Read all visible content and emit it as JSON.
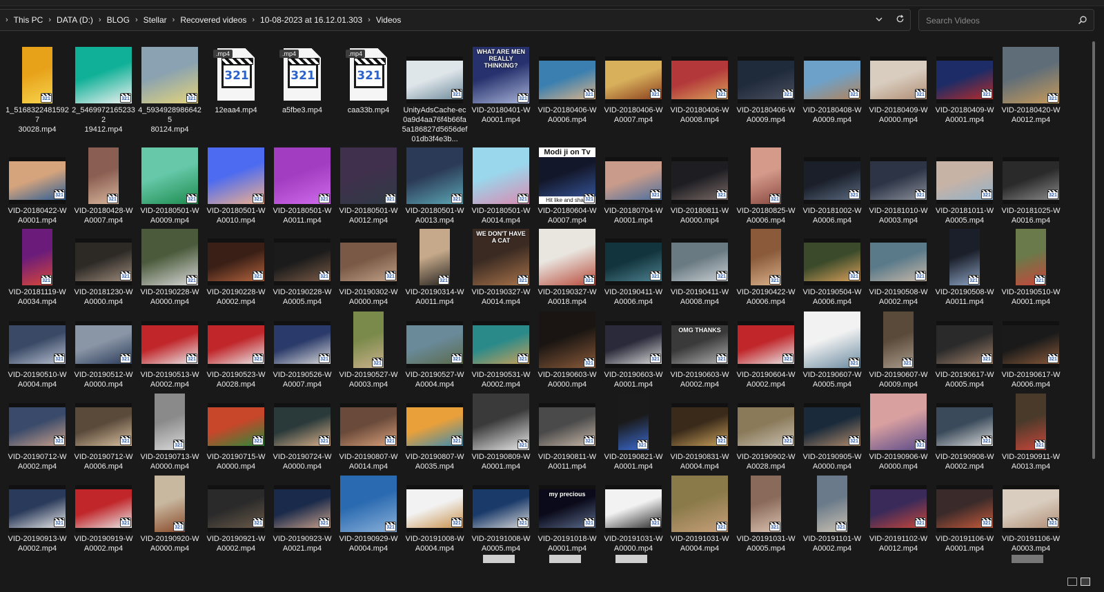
{
  "breadcrumb": [
    "This PC",
    "DATA (D:)",
    "BLOG",
    "Stellar",
    "Recovered videos",
    "10-08-2023 at 16.12.01.303",
    "Videos"
  ],
  "search": {
    "placeholder": "Search Videos"
  },
  "icons": {
    "chevron": "chevron-right-icon",
    "dropdown": "chevron-down-icon",
    "refresh": "refresh-icon",
    "search": "search-icon",
    "badge": "media-player-classic-icon",
    "details_view": "details-view-icon",
    "large_icons_view": "large-icons-view-icon"
  },
  "files": [
    {
      "name": "1_5168322481592730028.mp4",
      "kind": "portrait",
      "colors": [
        "#e7a21a",
        "#f7d54d"
      ]
    },
    {
      "name": "2_5469972165233219412.mp4",
      "kind": "square",
      "colors": [
        "#0fb097",
        "#f2f2f2"
      ]
    },
    {
      "name": "4_5934928986642580124.mp4",
      "kind": "square",
      "colors": [
        "#8aa2b1",
        "#e5d57a"
      ]
    },
    {
      "name": "12eaa4.mp4",
      "kind": "doc",
      "colors": []
    },
    {
      "name": "a5fbe3.mp4",
      "kind": "doc",
      "colors": []
    },
    {
      "name": "caa33b.mp4",
      "kind": "doc",
      "colors": []
    },
    {
      "name": "UnityAdsCache-ec0a9d4aa76f4b66fa5a186827d5656def01db3f4e3b...",
      "kind": "strip",
      "colors": [
        "#dfe6ea",
        "#6f8b9c"
      ]
    },
    {
      "name": "VID-20180401-WA0001.mp4",
      "kind": "square",
      "colors": [
        "#26316d",
        "#a8b4d8"
      ]
    },
    {
      "name": "VID-20180406-WA0006.mp4",
      "kind": "strip",
      "colors": [
        "#3a7fb0",
        "#d9b38a"
      ]
    },
    {
      "name": "VID-20180406-WA0007.mp4",
      "kind": "strip",
      "colors": [
        "#d8b05c",
        "#8a3e1d"
      ]
    },
    {
      "name": "VID-20180406-WA0008.mp4",
      "kind": "strip",
      "colors": [
        "#b3383a",
        "#d9a15a"
      ]
    },
    {
      "name": "VID-20180406-WA0009.mp4",
      "kind": "strip",
      "colors": [
        "#1f2a3a",
        "#4a4f60"
      ]
    },
    {
      "name": "VID-20180408-WA0009.mp4",
      "kind": "strip",
      "colors": [
        "#6ea1c9",
        "#b1835b"
      ]
    },
    {
      "name": "VID-20180409-WA0000.mp4",
      "kind": "strip",
      "colors": [
        "#d9cdbf",
        "#b08d74"
      ]
    },
    {
      "name": "VID-20180409-WA0001.mp4",
      "kind": "strip",
      "colors": [
        "#1d2c66",
        "#b82b2b"
      ]
    },
    {
      "name": "VID-20180420-WA0012.mp4",
      "kind": "square",
      "colors": [
        "#5f6d79",
        "#c89b59"
      ]
    },
    {
      "name": "VID-20180422-WA0001.mp4",
      "kind": "strip",
      "colors": [
        "#d6a47c",
        "#2b5d96"
      ]
    },
    {
      "name": "VID-20180428-WA0007.mp4",
      "kind": "portrait",
      "colors": [
        "#8a5e52",
        "#d8b59b"
      ]
    },
    {
      "name": "VID-20180501-WA0009.mp4",
      "kind": "square",
      "colors": [
        "#66c8a9",
        "#1e8c4e"
      ]
    },
    {
      "name": "VID-20180501-WA0010.mp4",
      "kind": "square",
      "colors": [
        "#4d6bf0",
        "#f1b08d"
      ]
    },
    {
      "name": "VID-20180501-WA0011.mp4",
      "kind": "square",
      "colors": [
        "#a23cc0",
        "#cf6bec"
      ]
    },
    {
      "name": "VID-20180501-WA0012.mp4",
      "kind": "square",
      "colors": [
        "#40304d",
        "#2f3a44"
      ]
    },
    {
      "name": "VID-20180501-WA0013.mp4",
      "kind": "square",
      "colors": [
        "#2b3a56",
        "#5ca7b5"
      ]
    },
    {
      "name": "VID-20180501-WA0014.mp4",
      "kind": "square",
      "colors": [
        "#9ad7ec",
        "#d98ab0"
      ]
    },
    {
      "name": "VID-20180604-WA0007.mp4",
      "kind": "square",
      "colors": [
        "#13172a",
        "#3a5da8"
      ]
    },
    {
      "name": "VID-20180704-WA0001.mp4",
      "kind": "strip",
      "colors": [
        "#c89b8a",
        "#4a6ea0"
      ]
    },
    {
      "name": "VID-20180811-WA0000.mp4",
      "kind": "strip",
      "colors": [
        "#1d1d22",
        "#7a6a66"
      ]
    },
    {
      "name": "VID-20180825-WA0006.mp4",
      "kind": "portrait",
      "colors": [
        "#d59a8a",
        "#8a4a42"
      ]
    },
    {
      "name": "VID-20181002-WA0006.mp4",
      "kind": "strip",
      "colors": [
        "#1a1f2a",
        "#5a6a80"
      ]
    },
    {
      "name": "VID-20181010-WA0003.mp4",
      "kind": "strip",
      "colors": [
        "#2c3446",
        "#8b8f99"
      ]
    },
    {
      "name": "VID-20181011-WA0005.mp4",
      "kind": "strip",
      "colors": [
        "#c7b3a6",
        "#8fb0c9"
      ]
    },
    {
      "name": "VID-20181025-WA0016.mp4",
      "kind": "strip",
      "colors": [
        "#2a2a2a",
        "#8a8a8a"
      ]
    },
    {
      "name": "VID-20181119-WA0034.mp4",
      "kind": "portrait",
      "colors": [
        "#6b1c7a",
        "#d8463a"
      ]
    },
    {
      "name": "VID-20181230-WA0000.mp4",
      "kind": "strip",
      "colors": [
        "#2d2a26",
        "#9d8a7a"
      ]
    },
    {
      "name": "VID-20190228-WA0000.mp4",
      "kind": "square",
      "colors": [
        "#4a5a3a",
        "#d9d9d9"
      ]
    },
    {
      "name": "VID-20190228-WA0002.mp4",
      "kind": "strip",
      "colors": [
        "#3a1f16",
        "#b5643e"
      ]
    },
    {
      "name": "VID-20190228-WA0005.mp4",
      "kind": "strip",
      "colors": [
        "#1b1b1b",
        "#7a5a46"
      ]
    },
    {
      "name": "VID-20190302-WA0000.mp4",
      "kind": "strip",
      "colors": [
        "#7a5a46",
        "#c2a089"
      ]
    },
    {
      "name": "VID-20190314-WA0011.mp4",
      "kind": "portrait",
      "colors": [
        "#c5a98a",
        "#2a2622"
      ]
    },
    {
      "name": "VID-20190327-WA0014.mp4",
      "kind": "square",
      "colors": [
        "#3a2a22",
        "#a8734a"
      ]
    },
    {
      "name": "VID-20190327-WA0018.mp4",
      "kind": "square",
      "colors": [
        "#e9e6e0",
        "#b84a3a"
      ]
    },
    {
      "name": "VID-20190411-WA0006.mp4",
      "kind": "strip",
      "colors": [
        "#12343c",
        "#4d8190"
      ]
    },
    {
      "name": "VID-20190411-WA0008.mp4",
      "kind": "strip",
      "colors": [
        "#6a7a82",
        "#c9d0d4"
      ]
    },
    {
      "name": "VID-20190422-WA0006.mp4",
      "kind": "portrait",
      "colors": [
        "#8a5a3a",
        "#d9b08a"
      ]
    },
    {
      "name": "VID-20190504-WA0006.mp4",
      "kind": "strip",
      "colors": [
        "#3a4a2a",
        "#d9a05a"
      ]
    },
    {
      "name": "VID-20190508-WA0002.mp4",
      "kind": "strip",
      "colors": [
        "#5a7a8a",
        "#c8b8a8"
      ]
    },
    {
      "name": "VID-20190508-WA0011.mp4",
      "kind": "portrait",
      "colors": [
        "#1a1f2a",
        "#8aa0c0"
      ]
    },
    {
      "name": "VID-20190510-WA0001.mp4",
      "kind": "portrait",
      "colors": [
        "#6a7a4a",
        "#c8463a"
      ]
    },
    {
      "name": "VID-20190510-WA0004.mp4",
      "kind": "strip",
      "colors": [
        "#3a4a66",
        "#b8c0d0"
      ]
    },
    {
      "name": "VID-20190512-WA0000.mp4",
      "kind": "strip",
      "colors": [
        "#8a96a6",
        "#2a3a5a"
      ]
    },
    {
      "name": "VID-20190513-WA0002.mp4",
      "kind": "strip",
      "colors": [
        "#c0262a",
        "#e9e9e9"
      ]
    },
    {
      "name": "VID-20190523-WA0028.mp4",
      "kind": "strip",
      "colors": [
        "#c0262a",
        "#e9e9e9"
      ]
    },
    {
      "name": "VID-20190526-WA0007.mp4",
      "kind": "strip",
      "colors": [
        "#2a3a6a",
        "#d9d9d9"
      ]
    },
    {
      "name": "VID-20190527-WA0003.mp4",
      "kind": "portrait",
      "colors": [
        "#7a8a4a",
        "#c8b08a"
      ]
    },
    {
      "name": "VID-20190527-WA0004.mp4",
      "kind": "strip",
      "colors": [
        "#6a8a9a",
        "#5a6a4a"
      ]
    },
    {
      "name": "VID-20190531-WA0002.mp4",
      "kind": "strip",
      "colors": [
        "#2a8a8a",
        "#c8a05a"
      ]
    },
    {
      "name": "VID-20190603-WA0000.mp4",
      "kind": "square",
      "colors": [
        "#1a1512",
        "#8a5a3a"
      ]
    },
    {
      "name": "VID-20190603-WA0001.mp4",
      "kind": "strip",
      "colors": [
        "#2a2a3a",
        "#d9d9d9"
      ]
    },
    {
      "name": "VID-20190603-WA0002.mp4",
      "kind": "strip",
      "colors": [
        "#3a3a3a",
        "#b0b0b0"
      ]
    },
    {
      "name": "VID-20190604-WA0002.mp4",
      "kind": "strip",
      "colors": [
        "#c0262a",
        "#e9e9e9"
      ]
    },
    {
      "name": "VID-20190607-WA0005.mp4",
      "kind": "square",
      "colors": [
        "#f2f2f2",
        "#6a8aa0"
      ]
    },
    {
      "name": "VID-20190607-WA0009.mp4",
      "kind": "portrait",
      "colors": [
        "#5a4a3a",
        "#a89a8a"
      ]
    },
    {
      "name": "VID-20190617-WA0005.mp4",
      "kind": "strip",
      "colors": [
        "#2a2a2a",
        "#a0806a"
      ]
    },
    {
      "name": "VID-20190617-WA0006.mp4",
      "kind": "strip",
      "colors": [
        "#1a1a1a",
        "#8a5a3a"
      ]
    },
    {
      "name": "VID-20190712-WA0002.mp4",
      "kind": "strip",
      "colors": [
        "#3a4a6a",
        "#c8a08a"
      ]
    },
    {
      "name": "VID-20190712-WA0006.mp4",
      "kind": "strip",
      "colors": [
        "#5a4a3a",
        "#d9c0a0"
      ]
    },
    {
      "name": "VID-20190713-WA0000.mp4",
      "kind": "portrait",
      "colors": [
        "#8a8a8a",
        "#d9d9d9"
      ]
    },
    {
      "name": "VID-20190715-WA0000.mp4",
      "kind": "strip",
      "colors": [
        "#c8462a",
        "#2a8a3a"
      ]
    },
    {
      "name": "VID-20190724-WA0000.mp4",
      "kind": "strip",
      "colors": [
        "#2a3a3a",
        "#d9b08a"
      ]
    },
    {
      "name": "VID-20190807-WA0014.mp4",
      "kind": "strip",
      "colors": [
        "#6a4a3a",
        "#d9a07a"
      ]
    },
    {
      "name": "VID-20190807-WA0035.mp4",
      "kind": "strip",
      "colors": [
        "#e9a03a",
        "#3a8ab0"
      ]
    },
    {
      "name": "VID-20190809-WA0001.mp4",
      "kind": "square",
      "colors": [
        "#3a3a3a",
        "#e9e9e9"
      ]
    },
    {
      "name": "VID-20190811-WA0011.mp4",
      "kind": "strip",
      "colors": [
        "#4a4a4a",
        "#c8b8a8"
      ]
    },
    {
      "name": "VID-20190821-WA0001.mp4",
      "kind": "portrait",
      "colors": [
        "#1a1a1a",
        "#3a6ad0"
      ]
    },
    {
      "name": "VID-20190831-WA0004.mp4",
      "kind": "strip",
      "colors": [
        "#3a2a1a",
        "#c8a05a"
      ]
    },
    {
      "name": "VID-20190902-WA0028.mp4",
      "kind": "strip",
      "colors": [
        "#8a7a5a",
        "#c8c0b0"
      ]
    },
    {
      "name": "VID-20190905-WA0000.mp4",
      "kind": "strip",
      "colors": [
        "#1a2a3a",
        "#b08a6a"
      ]
    },
    {
      "name": "VID-20190906-WA0000.mp4",
      "kind": "square",
      "colors": [
        "#d9a0a0",
        "#5a4a8a"
      ]
    },
    {
      "name": "VID-20190908-WA0002.mp4",
      "kind": "strip",
      "colors": [
        "#3a4a5a",
        "#d9d9d9"
      ]
    },
    {
      "name": "VID-20190911-WA0013.mp4",
      "kind": "portrait",
      "colors": [
        "#4a3a2a",
        "#c8463a"
      ]
    },
    {
      "name": "VID-20190913-WA0002.mp4",
      "kind": "strip",
      "colors": [
        "#2a3a5a",
        "#e9e9e9"
      ]
    },
    {
      "name": "VID-20190919-WA0002.mp4",
      "kind": "strip",
      "colors": [
        "#c0262a",
        "#e9e9e9"
      ]
    },
    {
      "name": "VID-20190920-WA0000.mp4",
      "kind": "portrait",
      "colors": [
        "#c8b8a0",
        "#8a4a2a"
      ]
    },
    {
      "name": "VID-20190921-WA0002.mp4",
      "kind": "strip",
      "colors": [
        "#2a2a2a",
        "#6a5a4a"
      ]
    },
    {
      "name": "VID-20190923-WA0021.mp4",
      "kind": "strip",
      "colors": [
        "#1a2a4a",
        "#c8a08a"
      ]
    },
    {
      "name": "VID-20190929-WA0004.mp4",
      "kind": "square",
      "colors": [
        "#2a6ab0",
        "#8ab0d9"
      ]
    },
    {
      "name": "VID-20191008-WA0004.mp4",
      "kind": "strip",
      "colors": [
        "#f2f2f2",
        "#c8904a"
      ]
    },
    {
      "name": "VID-20191008-WA0005.mp4",
      "kind": "strip",
      "colors": [
        "#1a3a6a",
        "#d9d9d9"
      ]
    },
    {
      "name": "VID-20191018-WA0001.mp4",
      "kind": "strip",
      "colors": [
        "#0a0a1a",
        "#5a6a8a"
      ]
    },
    {
      "name": "VID-20191031-WA0000.mp4",
      "kind": "strip",
      "colors": [
        "#f2f2f2",
        "#2a2a2a"
      ]
    },
    {
      "name": "VID-20191031-WA0004.mp4",
      "kind": "square",
      "colors": [
        "#8a7a4a",
        "#c8a07a"
      ]
    },
    {
      "name": "VID-20191031-WA0005.mp4",
      "kind": "portrait",
      "colors": [
        "#8a6a5a",
        "#d9c0b0"
      ]
    },
    {
      "name": "VID-20191101-WA0002.mp4",
      "kind": "portrait",
      "colors": [
        "#6a7a8a",
        "#c8c0b0"
      ]
    },
    {
      "name": "VID-20191102-WA0012.mp4",
      "kind": "strip",
      "colors": [
        "#3a2a5a",
        "#c8463a"
      ]
    },
    {
      "name": "VID-20191106-WA0001.mp4",
      "kind": "strip",
      "colors": [
        "#3a2a2a",
        "#c85a3a"
      ]
    },
    {
      "name": "VID-20191106-WA0003.mp4",
      "kind": "strip",
      "colors": [
        "#d9cdbf",
        "#b08d74"
      ]
    }
  ],
  "thumb_text": {
    "VID-20180401-WA0001.mp4": "WHAT ARE MEN REALLY THINKING?",
    "VID-20180604-WA0007.mp4": "Modi ji on Tv",
    "VID-20180604-WA0007.mp4_bottom": "Hit like and share",
    "VID-20190327-WA0014.mp4": "WE DON'T HAVE A CAT",
    "VID-20190603-WA0002.mp4": "OMG THANKS",
    "VID-20191018-WA0001.mp4": "my precious"
  }
}
